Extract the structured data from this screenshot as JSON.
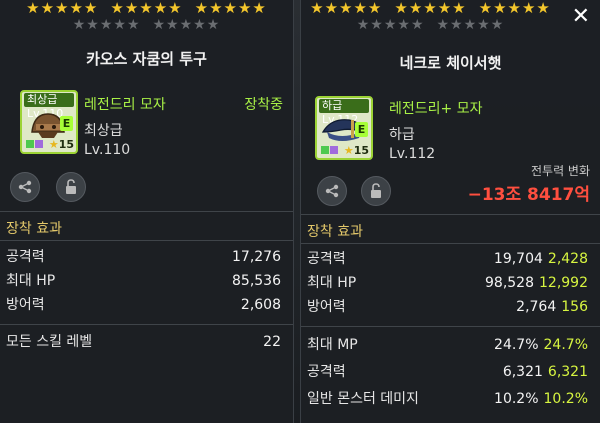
{
  "left": {
    "stars_gold": [
      "★★★★★",
      "★★★★★",
      "★★★★★"
    ],
    "stars_grey": [
      "★★★★★",
      "★★★★★"
    ],
    "title": "카오스 자쿰의 투구",
    "grade_tag": "최상급",
    "grade_level": "Lv.110",
    "e_badge": "E",
    "star_force": "15",
    "potential": "레전드리 모자",
    "equipped": "장착중",
    "grade": "최상급",
    "level": "Lv.110",
    "section": "장착 효과",
    "stats": [
      {
        "label": "공격력",
        "value": "17,276"
      },
      {
        "label": "최대 HP",
        "value": "85,536"
      },
      {
        "label": "방어력",
        "value": "2,608"
      }
    ],
    "stats2": [
      {
        "label": "모든 스킬 레벨",
        "value": "22"
      }
    ],
    "accent": "#a8f046"
  },
  "right": {
    "stars_gold": [
      "★★★★★",
      "★★★★★",
      "★★★★★"
    ],
    "stars_grey": [
      "★★★★★",
      "★★★★★"
    ],
    "title": "네크로 체이서햇",
    "grade_tag": "하급",
    "grade_level": "Lv.112",
    "e_badge": "E",
    "star_force": "15",
    "potential": "레전드리+ 모자",
    "grade": "하급",
    "level": "Lv.112",
    "combat_label": "전투력 변화",
    "combat_value": "−13조 8417억",
    "section": "장착 효과",
    "stats": [
      {
        "label": "공격력",
        "value": "19,704",
        "inc": "2,428"
      },
      {
        "label": "최대 HP",
        "value": "98,528",
        "inc": "12,992"
      },
      {
        "label": "방어력",
        "value": "2,764",
        "inc": "156"
      }
    ],
    "stats2": [
      {
        "label": "최대 MP",
        "value": "24.7%",
        "inc": "24.7%"
      },
      {
        "label": "공격력",
        "value": "6,321",
        "inc": "6,321"
      },
      {
        "label": "일반 몬스터 데미지",
        "value": "10.2%",
        "inc": "10.2%"
      }
    ],
    "close": "✕",
    "combat_color": "#ff4f3f"
  }
}
